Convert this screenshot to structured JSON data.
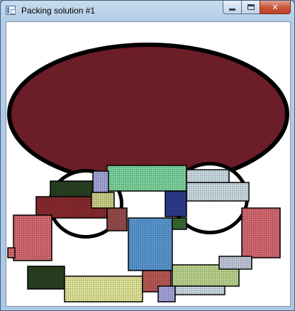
{
  "window": {
    "title": "Packing solution #1",
    "icon": "application-window-icon",
    "buttons": [
      {
        "name": "minimize",
        "icon": "minimize-icon"
      },
      {
        "name": "maximize",
        "icon": "maximize-icon"
      },
      {
        "name": "close",
        "icon": "close-icon",
        "glyph": "✕"
      }
    ]
  },
  "canvas": {
    "background": "#ffffff",
    "container_color": "#6b1d28",
    "outline_color": "#000000",
    "piece_colors": [
      "#7fd7a0",
      "#cfd48a",
      "#5b9ad6",
      "#d96b72",
      "#2e3c8f",
      "#8b2b2f",
      "#9a4c4c",
      "#cfe0e8",
      "#294222",
      "#e6ea9c",
      "#c6cde0",
      "#bfd98f",
      "#3b6b34",
      "#a8a8e0",
      "#bd5a56"
    ]
  }
}
